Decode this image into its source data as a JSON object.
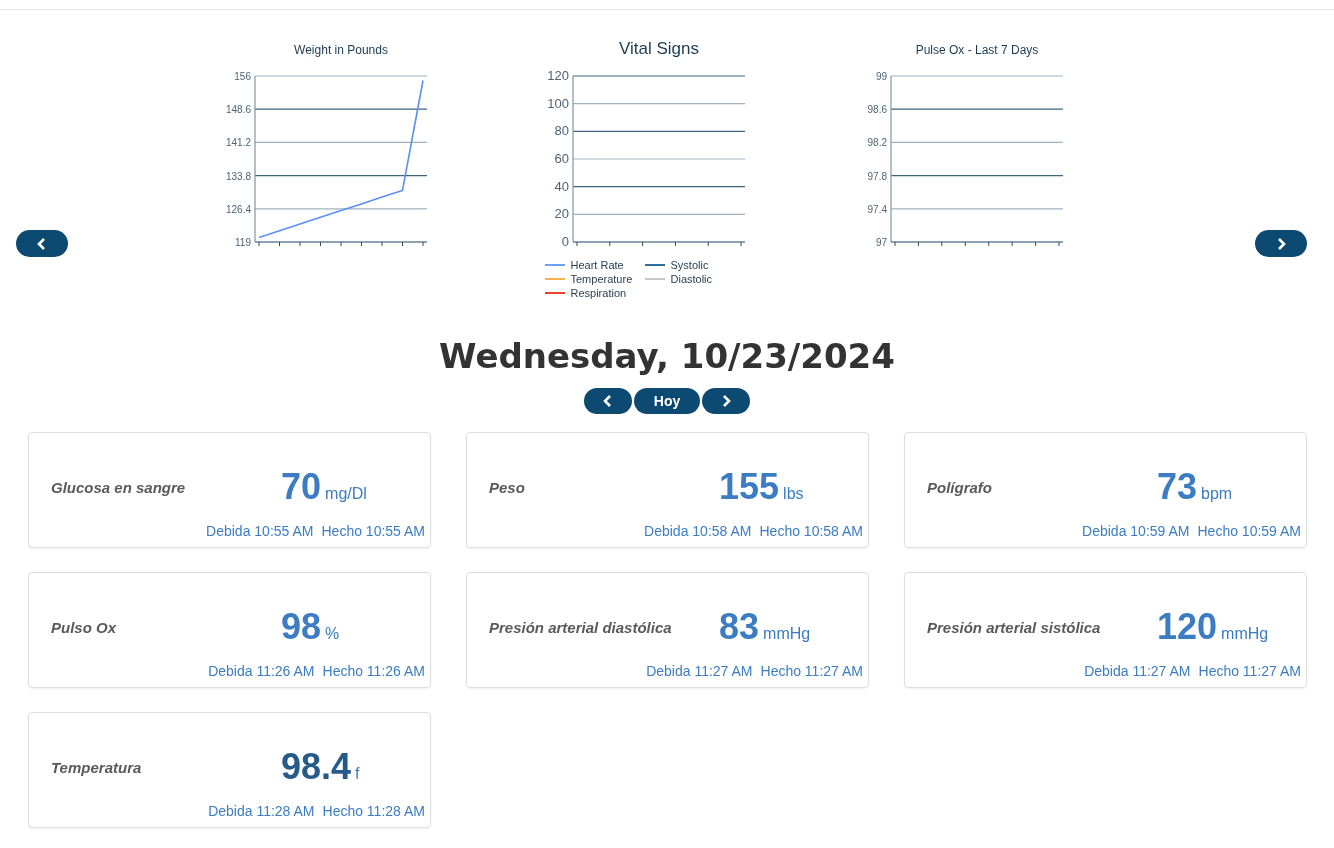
{
  "charts": [
    {
      "chart_data": {
        "type": "line",
        "title": "Weight in Pounds",
        "grid": true,
        "categories": [
          null,
          null,
          null,
          null,
          null,
          null,
          null,
          null,
          null
        ],
        "ylim": [
          119,
          156
        ],
        "yticks": [
          119,
          126.4,
          133.8,
          141.2,
          148.6,
          156
        ],
        "series": [
          {
            "color": "#5b8ff0",
            "values": [
              120,
              121.5,
              123,
              124.5,
              126,
              127.5,
              129,
              130.5,
              155
            ]
          }
        ]
      }
    },
    {
      "chart_data": {
        "type": "line",
        "title": "Vital Signs",
        "grid": true,
        "categories": [
          null,
          null,
          null,
          null,
          null,
          null
        ],
        "ylim": [
          0,
          120
        ],
        "yticks": [
          0,
          20,
          40,
          60,
          80,
          100,
          120
        ],
        "series": [
          {
            "name": "Heart Rate",
            "color": "#6ea0f5",
            "values": [
              null,
              null,
              null,
              null,
              null,
              null
            ]
          },
          {
            "name": "Systolic",
            "color": "#2f6f9e",
            "values": [
              null,
              null,
              null,
              null,
              null,
              null
            ]
          },
          {
            "name": "Temperature",
            "color": "#f7b350",
            "values": [
              null,
              null,
              null,
              null,
              null,
              null
            ]
          },
          {
            "name": "Diastolic",
            "color": "#c8c8c8",
            "values": [
              null,
              null,
              null,
              null,
              null,
              null
            ]
          },
          {
            "name": "Respiration",
            "color": "#e8452a",
            "values": [
              null,
              null,
              null,
              null,
              null,
              null
            ]
          }
        ]
      }
    },
    {
      "chart_data": {
        "type": "line",
        "title": "Pulse Ox - Last 7 Days",
        "grid": true,
        "categories": [
          null,
          null,
          null,
          null,
          null,
          null,
          null,
          null
        ],
        "ylim": [
          97,
          99
        ],
        "yticks": [
          97,
          97.4,
          97.8,
          98.2,
          98.6,
          99
        ]
      }
    }
  ],
  "date": "Wednesday, 10/23/2024",
  "today_button": "Hoy",
  "cards": [
    {
      "title": "Glucosa en sangre",
      "value": "70",
      "unit": "mg/Dl",
      "due": "Debida 10:55 AM",
      "done": "Hecho 10:55 AM",
      "color": "#3b7cc2"
    },
    {
      "title": "Peso",
      "value": "155",
      "unit": "lbs",
      "due": "Debida 10:58 AM",
      "done": "Hecho 10:58 AM",
      "color": "#3b7cc2"
    },
    {
      "title": "Polígrafo",
      "value": "73",
      "unit": "bpm",
      "due": "Debida 10:59 AM",
      "done": "Hecho 10:59 AM",
      "color": "#3b7cc2"
    },
    {
      "title": "Pulso Ox",
      "value": "98",
      "unit": "%",
      "due": "Debida 11:26 AM",
      "done": "Hecho 11:26 AM",
      "color": "#3b7cc2"
    },
    {
      "title": "Presión arterial diastólica",
      "value": "83",
      "unit": "mmHg",
      "due": "Debida 11:27 AM",
      "done": "Hecho 11:27 AM",
      "color": "#3b7cc2"
    },
    {
      "title": "Presión arterial sistólica",
      "value": "120",
      "unit": "mmHg",
      "due": "Debida 11:27 AM",
      "done": "Hecho 11:27 AM",
      "color": "#3b7cc2"
    },
    {
      "title": "Temperatura",
      "value": "98.4",
      "unit": "f",
      "due": "Debida 11:28 AM",
      "done": "Hecho 11:28 AM",
      "color": "#265a8a"
    }
  ]
}
